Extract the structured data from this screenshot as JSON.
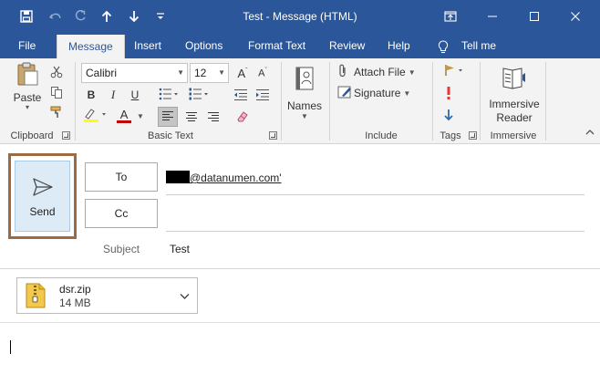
{
  "window": {
    "title": "Test  -  Message (HTML)",
    "icons": [
      "save-icon",
      "undo-icon",
      "redo-icon",
      "up-arrow-icon",
      "down-arrow-icon",
      "customize-qat-icon",
      "ribbon-display-icon",
      "minimize-icon",
      "maximize-icon",
      "close-icon"
    ]
  },
  "tabs": [
    {
      "label": "File"
    },
    {
      "label": "Message"
    },
    {
      "label": "Insert"
    },
    {
      "label": "Options"
    },
    {
      "label": "Format Text"
    },
    {
      "label": "Review"
    },
    {
      "label": "Help"
    }
  ],
  "tell_me": {
    "label": "Tell me"
  },
  "ribbon": {
    "clipboard": {
      "paste_label": "Paste",
      "group_label": "Clipboard"
    },
    "basic_text": {
      "font_name": "Calibri",
      "font_size": "12",
      "bold": "B",
      "italic": "I",
      "underline": "U",
      "font_color_glyph": "A",
      "group_label": "Basic Text"
    },
    "names": {
      "label": "Names"
    },
    "include": {
      "attach_file_label": "Attach File",
      "signature_label": "Signature",
      "group_label": "Include"
    },
    "tags": {
      "group_label": "Tags"
    },
    "immersive": {
      "reader_line1": "Immersive",
      "reader_line2": "Reader",
      "group_label": "Immersive"
    }
  },
  "compose": {
    "send_label": "Send",
    "to_label": "To",
    "cc_label": "Cc",
    "to_value": "@datanumen.com'",
    "subject_label": "Subject",
    "subject_value": "Test"
  },
  "attachment": {
    "name": "dsr.zip",
    "size": "14 MB"
  },
  "colors": {
    "accent": "#2b579a",
    "ribbon_bg": "#f3f3f3",
    "send_bg": "#dcebf6",
    "highlight_frame": "#9b6b45",
    "highlighter": "#ffff00",
    "font_color": "#c00000",
    "importance_high": "#e53935",
    "importance_low": "#2b6cb0"
  }
}
